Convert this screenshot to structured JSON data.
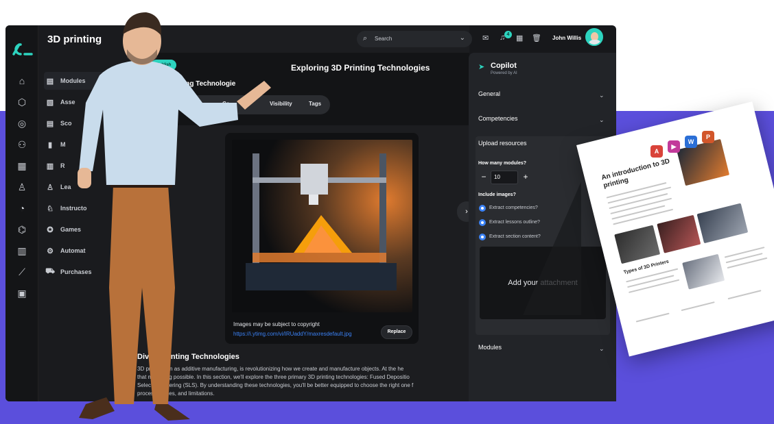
{
  "app": {
    "title": "3D printing",
    "logo": "logo-mark"
  },
  "topbar": {
    "search_placeholder": "Search",
    "notification_count": "4",
    "user_name": "John Willis"
  },
  "sidebar": {
    "items": [
      {
        "label": "Modules",
        "icon": "modules-icon"
      },
      {
        "label": "Asse",
        "icon": "assessment-icon"
      },
      {
        "label": "Sco",
        "icon": "scorm-icon"
      },
      {
        "label": "M",
        "icon": "chart-icon"
      },
      {
        "label": "R",
        "icon": "resources-icon"
      },
      {
        "label": "Lea",
        "icon": "learners-icon"
      },
      {
        "label": "Instructo",
        "icon": "instructor-icon"
      },
      {
        "label": "Games",
        "icon": "games-icon"
      },
      {
        "label": "Automat",
        "icon": "automation-icon"
      },
      {
        "label": "Purchases",
        "icon": "cart-icon"
      }
    ]
  },
  "main": {
    "pill": "Publish",
    "hero_title": "Exploring 3D Printing Technologies",
    "subtitle": "nting Technologie",
    "tabs": [
      "rces",
      "Co",
      "Visibility",
      "Tags"
    ],
    "image_note": "Images may be subject to copyright",
    "image_link": "https://i.ytimg.com/vi/IRUaddY/maxresdefault.jpg",
    "replace_label": "Replace",
    "section_title": "Divi         D Printing Technologies",
    "section_lines": [
      "3D pr           o known as additive manufacturing, is revolutionizing how we create and manufacture objects. At the he",
      "that m          printing possible. In this section, we'll explore the three primary 3D printing technologies: Fused Depositio",
      "Selecti          e Sintering (SLS). By understanding these technologies, you'll be better equipped to choose the right one f",
      "proces          antages, and limitations."
    ]
  },
  "copilot": {
    "title": "Copilot",
    "subtitle": "Powered by AI",
    "general": "General",
    "competencies": "Competencies",
    "upload_resources": "Upload resources",
    "how_many_label": "How many modules?",
    "modules_value": "10",
    "include_images": "Include images?",
    "options": [
      "Extract competencies?",
      "Extract lessons outline?",
      "Extract section content?"
    ],
    "attachment": "Add your attachment",
    "modules": "Modules"
  },
  "doc": {
    "title": "An introduction to 3D printing",
    "section": "Types of 3D Printers"
  },
  "colors": {
    "accent": "#2dd4bf",
    "link": "#3b82f6",
    "band": "#5b4fdc",
    "app_bg": "#17181b"
  }
}
